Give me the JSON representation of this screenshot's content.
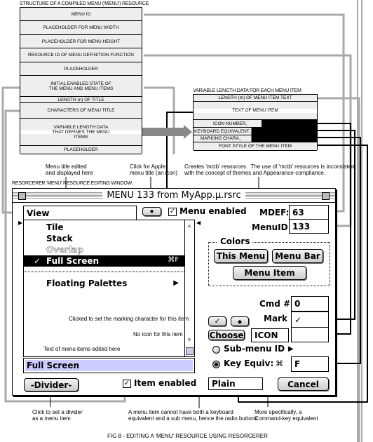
{
  "structure": {
    "title": "STRUCTURE OF A COMPILED MENU ('MENU') RESOURCE",
    "rows": [
      "MENU ID",
      "PLACEHOLDER FOR MENU WIDTH",
      "PLACEHOLDER FOR MENU HEIGHT",
      "RESOURCE ID OF MENU DEFINITION FUNCTION",
      "PLACEHOLDER",
      "INITIAL ENABLED STATE OF THE MENU AND MENU ITEMS",
      "LENGTH (n) OF TITLE",
      "CHARACTERS OF MENU TITLE",
      "VARIABLE LENGTH DATA THAT DEFINES THE MENU ITEMS",
      "PLACEHOLDER"
    ]
  },
  "item_structure": {
    "title": "VARIABLE LENGTH DATA FOR EACH MENU ITEM",
    "rows": [
      "LENGTH (m) OF MENU ITEM TEXT",
      "TEXT OF MENU ITEM",
      "ICON NUMBER,",
      "KEYBOARD EQUIVALENT,",
      "MARKING CHARA.,",
      "FONT STYLE OF THE MENU ITEM"
    ]
  },
  "annotations": {
    "title_edit": "Menu title edited\nand displayed here",
    "apple": "Click for Apple\nmenu title (an icon)",
    "mctb": "Creates 'mctb' resources.  The use of 'mctb' resources is inconsistent\nwith the concept of themes and Appearance-compliance.",
    "mark": "Clicked to set the marking character for this item",
    "no_icon": "No icon for this item",
    "item_text": "Text of menu items edited here",
    "divider": "Click to set a divider\nas a menu item",
    "radio": "A menu item cannot have both a keyboard\nequivalent and a sub menu, hence the radio buttons",
    "cmdkey": "More specifically, a\nCommand-key equivalent"
  },
  "window_label": "RESORCERER 'MENU' RESOURCE EDITING WINDOW",
  "window": {
    "title": "MENU 133 from MyApp.µ.rsrc",
    "menu_title": "View",
    "menu_enabled": "Menu enabled",
    "mdef_label": "MDEF:",
    "mdef": "63",
    "menuid_label": "MenuID:",
    "menuid": "133",
    "items": [
      {
        "label": "Tile"
      },
      {
        "label": "Stack"
      },
      {
        "label": "Overlap",
        "disabled": true
      },
      {
        "label": "Full Screen",
        "mark": "✓",
        "key": "⌘F",
        "selected": true
      },
      {
        "label": "-"
      },
      {
        "label": "Floating Palettes",
        "submenu": true
      }
    ],
    "colors_label": "Colors",
    "this_menu": "This Menu",
    "menu_bar": "Menu Bar",
    "menu_item": "Menu Item",
    "cmd_label": "Cmd #",
    "cmd": "0",
    "mark_label": "Mark",
    "mark": "✓",
    "check_btn": "✓",
    "diamond_btn": "◆",
    "choose": "Choose",
    "icon_label": "ICON",
    "icon_value": "",
    "submenu_label": "Sub-menu ID",
    "keyequiv_label": "Key Equiv:",
    "cmd_symbol": "⌘",
    "key": "F",
    "item_text": "Full Screen",
    "divider": "-Divider-",
    "item_enabled": "Item enabled",
    "style": "Plain",
    "cancel": "Cancel"
  },
  "caption": "FIG 8 - EDITING A 'MENU' RESOURCE USING RESORCERER",
  "colors": {
    "selection_field": "#ccccff",
    "gray_connector": "#aaaaaa"
  }
}
